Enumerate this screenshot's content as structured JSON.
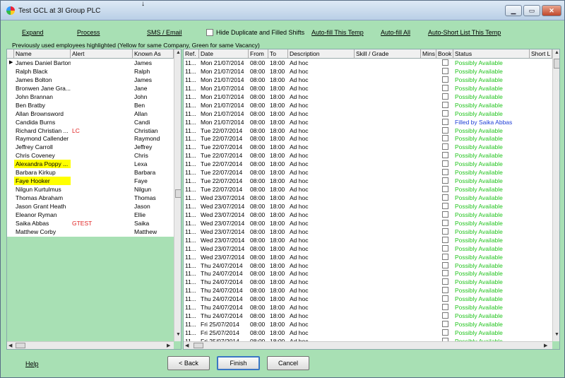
{
  "window": {
    "title": "Test GCL at 3I Group PLC"
  },
  "toolbar": {
    "expand": "Expand",
    "process": "Process",
    "sms_email": "SMS / Email",
    "hide_label": "Hide Duplicate and Filled Shifts",
    "autofill_temp": "Auto-fill This Temp",
    "autofill_all": "Auto-fill All",
    "auto_short_list": "Auto-Short List This Temp"
  },
  "hint": "Previously used employees highlighted (Yellow for same Company, Green for same Vacancy)",
  "employees": {
    "headers": {
      "name": "Name",
      "alert": "Alert",
      "known_as": "Known As"
    },
    "rows": [
      {
        "name": "James Daniel Barton",
        "alert": "",
        "known": "James"
      },
      {
        "name": "Ralph Black",
        "alert": "",
        "known": "Ralph"
      },
      {
        "name": "James Bolton",
        "alert": "",
        "known": "James"
      },
      {
        "name": "Bronwen Jane Gra...",
        "alert": "",
        "known": "Jane"
      },
      {
        "name": "John Brannan",
        "alert": "",
        "known": "John"
      },
      {
        "name": "Ben Bratby",
        "alert": "",
        "known": "Ben"
      },
      {
        "name": "Allan Brownsword",
        "alert": "",
        "known": "Allan"
      },
      {
        "name": "Candida Burns",
        "alert": "",
        "known": "Candi"
      },
      {
        "name": "Richard Christian ...",
        "alert": "LC",
        "known": "Christian"
      },
      {
        "name": "Raymond Callender",
        "alert": "",
        "known": "Raymond"
      },
      {
        "name": "Jeffrey Carroll",
        "alert": "",
        "known": "Jeffrey"
      },
      {
        "name": "Chris Coveney",
        "alert": "",
        "known": "Chris"
      },
      {
        "name": "Alexandra Poppy ...",
        "alert": "",
        "known": "Lexa"
      },
      {
        "name": "Barbara Kirkup",
        "alert": "",
        "known": "Barbara"
      },
      {
        "name": "Faye Hooker",
        "alert": "",
        "known": "Faye"
      },
      {
        "name": "Nilgun Kurtulmus",
        "alert": "",
        "known": "Nilgun"
      },
      {
        "name": "Thomas Abraham",
        "alert": "",
        "known": "Thomas"
      },
      {
        "name": "Jason Grant Heath",
        "alert": "",
        "known": "Jason"
      },
      {
        "name": "Eleanor Ryman",
        "alert": "",
        "known": "Ellie"
      },
      {
        "name": "Saika Abbas",
        "alert": "GTEST",
        "known": "Saika"
      },
      {
        "name": "Matthew Corby",
        "alert": "",
        "known": "Matthew"
      }
    ]
  },
  "shifts": {
    "headers": {
      "ref": "Ref.",
      "date": "Date",
      "from": "From",
      "to": "To",
      "description": "Description",
      "skill": "Skill / Grade",
      "mins": "Mins",
      "book": "Book",
      "status": "Status",
      "short": "Short L"
    },
    "rows": [
      {
        "ref": "11...",
        "date": "Mon 21/07/2014",
        "from": "08:00",
        "to": "18:00",
        "desc": "Ad hoc",
        "status": "Possibly Available"
      },
      {
        "ref": "11...",
        "date": "Mon 21/07/2014",
        "from": "08:00",
        "to": "18:00",
        "desc": "Ad hoc",
        "status": "Possibly Available"
      },
      {
        "ref": "11...",
        "date": "Mon 21/07/2014",
        "from": "08:00",
        "to": "18:00",
        "desc": "Ad hoc",
        "status": "Possibly Available"
      },
      {
        "ref": "11...",
        "date": "Mon 21/07/2014",
        "from": "08:00",
        "to": "18:00",
        "desc": "Ad hoc",
        "status": "Possibly Available"
      },
      {
        "ref": "11...",
        "date": "Mon 21/07/2014",
        "from": "08:00",
        "to": "18:00",
        "desc": "Ad hoc",
        "status": "Possibly Available"
      },
      {
        "ref": "11...",
        "date": "Mon 21/07/2014",
        "from": "08:00",
        "to": "18:00",
        "desc": "Ad hoc",
        "status": "Possibly Available"
      },
      {
        "ref": "11...",
        "date": "Mon 21/07/2014",
        "from": "08:00",
        "to": "18:00",
        "desc": "Ad hoc",
        "status": "Possibly Available"
      },
      {
        "ref": "11...",
        "date": "Mon 21/07/2014",
        "from": "08:00",
        "to": "18:00",
        "desc": "Ad hoc",
        "status": "Filled by Saika Abbas"
      },
      {
        "ref": "11...",
        "date": "Tue 22/07/2014",
        "from": "08:00",
        "to": "18:00",
        "desc": "Ad hoc",
        "status": "Possibly Available"
      },
      {
        "ref": "11...",
        "date": "Tue 22/07/2014",
        "from": "08:00",
        "to": "18:00",
        "desc": "Ad hoc",
        "status": "Possibly Available"
      },
      {
        "ref": "11...",
        "date": "Tue 22/07/2014",
        "from": "08:00",
        "to": "18:00",
        "desc": "Ad hoc",
        "status": "Possibly Available"
      },
      {
        "ref": "11...",
        "date": "Tue 22/07/2014",
        "from": "08:00",
        "to": "18:00",
        "desc": "Ad hoc",
        "status": "Possibly Available"
      },
      {
        "ref": "11...",
        "date": "Tue 22/07/2014",
        "from": "08:00",
        "to": "18:00",
        "desc": "Ad hoc",
        "status": "Possibly Available"
      },
      {
        "ref": "11...",
        "date": "Tue 22/07/2014",
        "from": "08:00",
        "to": "18:00",
        "desc": "Ad hoc",
        "status": "Possibly Available"
      },
      {
        "ref": "11...",
        "date": "Tue 22/07/2014",
        "from": "08:00",
        "to": "18:00",
        "desc": "Ad hoc",
        "status": "Possibly Available"
      },
      {
        "ref": "11...",
        "date": "Tue 22/07/2014",
        "from": "08:00",
        "to": "18:00",
        "desc": "Ad hoc",
        "status": "Possibly Available"
      },
      {
        "ref": "11...",
        "date": "Wed 23/07/2014",
        "from": "08:00",
        "to": "18:00",
        "desc": "Ad hoc",
        "status": "Possibly Available"
      },
      {
        "ref": "11...",
        "date": "Wed 23/07/2014",
        "from": "08:00",
        "to": "18:00",
        "desc": "Ad hoc",
        "status": "Possibly Available"
      },
      {
        "ref": "11...",
        "date": "Wed 23/07/2014",
        "from": "08:00",
        "to": "18:00",
        "desc": "Ad hoc",
        "status": "Possibly Available"
      },
      {
        "ref": "11...",
        "date": "Wed 23/07/2014",
        "from": "08:00",
        "to": "18:00",
        "desc": "Ad hoc",
        "status": "Possibly Available"
      },
      {
        "ref": "11...",
        "date": "Wed 23/07/2014",
        "from": "08:00",
        "to": "18:00",
        "desc": "Ad hoc",
        "status": "Possibly Available"
      },
      {
        "ref": "11...",
        "date": "Wed 23/07/2014",
        "from": "08:00",
        "to": "18:00",
        "desc": "Ad hoc",
        "status": "Possibly Available"
      },
      {
        "ref": "11...",
        "date": "Wed 23/07/2014",
        "from": "08:00",
        "to": "18:00",
        "desc": "Ad hoc",
        "status": "Possibly Available"
      },
      {
        "ref": "11...",
        "date": "Wed 23/07/2014",
        "from": "08:00",
        "to": "18:00",
        "desc": "Ad hoc",
        "status": "Possibly Available"
      },
      {
        "ref": "11...",
        "date": "Thu 24/07/2014",
        "from": "08:00",
        "to": "18:00",
        "desc": "Ad hoc",
        "status": "Possibly Available"
      },
      {
        "ref": "11...",
        "date": "Thu 24/07/2014",
        "from": "08:00",
        "to": "18:00",
        "desc": "Ad hoc",
        "status": "Possibly Available"
      },
      {
        "ref": "11...",
        "date": "Thu 24/07/2014",
        "from": "08:00",
        "to": "18:00",
        "desc": "Ad hoc",
        "status": "Possibly Available"
      },
      {
        "ref": "11...",
        "date": "Thu 24/07/2014",
        "from": "08:00",
        "to": "18:00",
        "desc": "Ad hoc",
        "status": "Possibly Available"
      },
      {
        "ref": "11...",
        "date": "Thu 24/07/2014",
        "from": "08:00",
        "to": "18:00",
        "desc": "Ad hoc",
        "status": "Possibly Available"
      },
      {
        "ref": "11...",
        "date": "Thu 24/07/2014",
        "from": "08:00",
        "to": "18:00",
        "desc": "Ad hoc",
        "status": "Possibly Available"
      },
      {
        "ref": "11...",
        "date": "Thu 24/07/2014",
        "from": "08:00",
        "to": "18:00",
        "desc": "Ad hoc",
        "status": "Possibly Available"
      },
      {
        "ref": "11...",
        "date": "Fri 25/07/2014",
        "from": "08:00",
        "to": "18:00",
        "desc": "Ad hoc",
        "status": "Possibly Available"
      },
      {
        "ref": "11...",
        "date": "Fri 25/07/2014",
        "from": "08:00",
        "to": "18:00",
        "desc": "Ad hoc",
        "status": "Possibly Available"
      },
      {
        "ref": "11...",
        "date": "Fri 25/07/2014",
        "from": "08:00",
        "to": "18:00",
        "desc": "Ad hoc",
        "status": "Possibly Available"
      }
    ]
  },
  "footer": {
    "help": "Help",
    "back": "< Back",
    "finish": "Finish",
    "cancel": "Cancel"
  },
  "colors": {
    "available": "#22c41e",
    "filled": "#1f3fd6",
    "alert": "#e02020",
    "highlight": "#ffff00",
    "window_bg": "#a8e0b4"
  }
}
